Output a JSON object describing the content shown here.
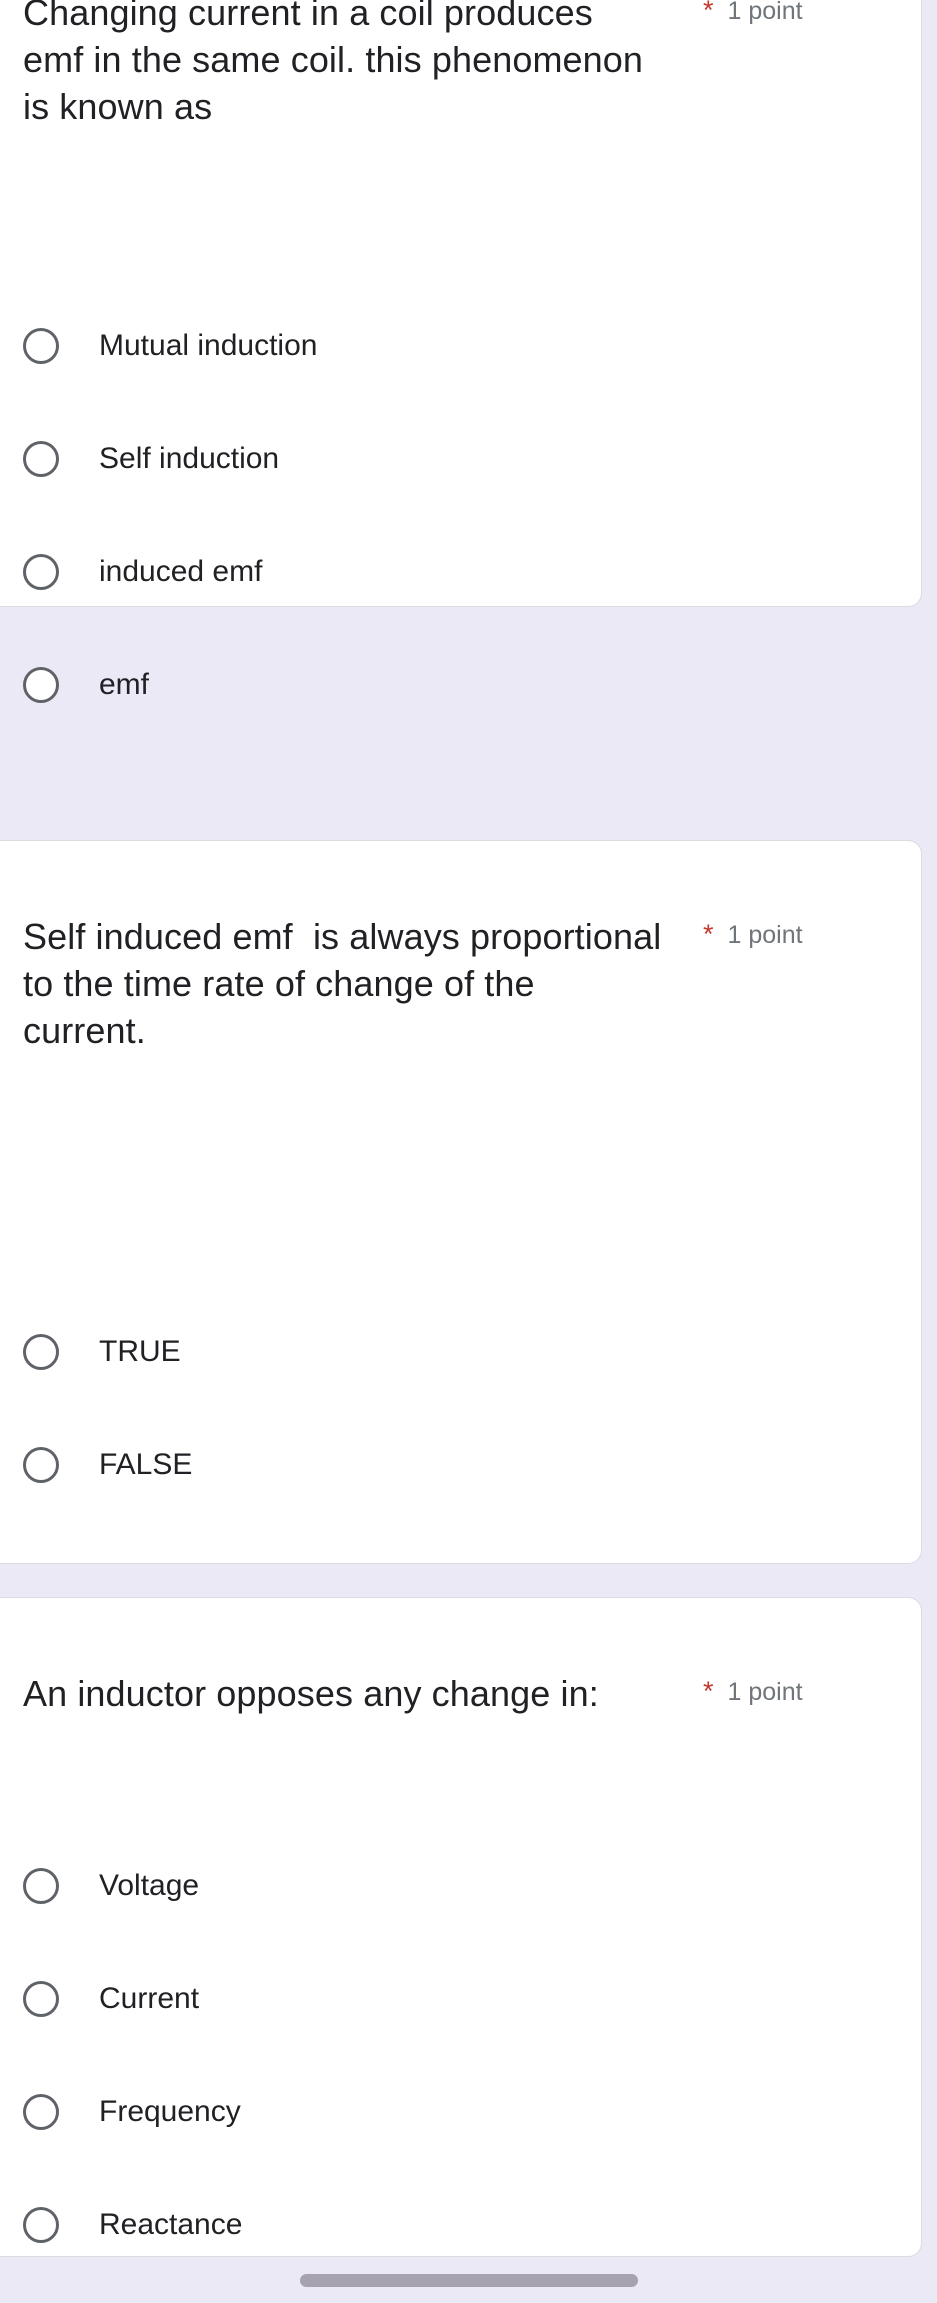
{
  "app": {
    "type": "google-forms-quiz",
    "background_color": "#ece9f6",
    "card_color": "#ffffff",
    "required_star_color": "#c5372c",
    "point_label_color": "#70757a",
    "radio_outline_color": "#5f6368",
    "home_indicator_color": "#a6a2ae"
  },
  "questions": [
    {
      "id": "q1",
      "text": "Changing current in a coil produces emf in the same coil. this phenomenon is known as",
      "required_marker": "*",
      "points": "1 point",
      "clipped_top": true,
      "options": [
        {
          "label": "Mutual induction",
          "selected": false
        },
        {
          "label": "Self induction",
          "selected": false
        },
        {
          "label": "induced emf",
          "selected": false
        },
        {
          "label": "emf",
          "selected": false
        }
      ]
    },
    {
      "id": "q2",
      "text": "Self induced emf  is always proportional to the time rate of change of the current.",
      "required_marker": "*",
      "points": "1 point",
      "clipped_top": false,
      "options": [
        {
          "label": "TRUE",
          "selected": false
        },
        {
          "label": "FALSE",
          "selected": false
        }
      ]
    },
    {
      "id": "q3",
      "text": "An inductor opposes any change in:",
      "required_marker": "*",
      "points": "1 point",
      "clipped_top": false,
      "options": [
        {
          "label": "Voltage",
          "selected": false
        },
        {
          "label": "Current",
          "selected": false
        },
        {
          "label": "Frequency",
          "selected": false
        },
        {
          "label": "Reactance",
          "selected": false
        }
      ]
    }
  ]
}
